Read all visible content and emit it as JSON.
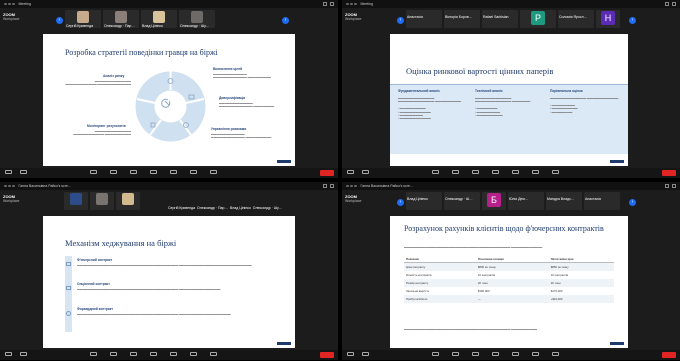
{
  "quadrants": [
    {
      "window_title": "Meeting",
      "brand": [
        "ZOOM",
        "Workplace"
      ],
      "participants": [
        "Сергій Кривенда",
        "Олександр · Пар…",
        "Влад Цінінко",
        "Олександр · Шу…"
      ],
      "participant_subs": [
        "",
        "",
        "",
        "Владислав Шумельчу…"
      ],
      "slide_title": "Розробка стратегії поведінки гравця на біржі",
      "labels": [
        "Аналіз ринку",
        "Моніторинг результатів",
        "Визначення цілей",
        "Диверсифікація",
        "Управління ризиками"
      ]
    },
    {
      "window_title": "Meeting",
      "brand": [
        "ZOOM",
        "Workplace"
      ],
      "participants": [
        "Анастасія",
        "Вікторія Боров…",
        "Rafael Sarkisian",
        "Соломія Яросл…"
      ],
      "participant_subs": [
        "",
        "",
        "",
        ""
      ],
      "slide_title": "Оцінка ринкової вартості цінних паперів",
      "columns": [
        "Фундаментальний аналіз",
        "Технічний аналіз",
        "Порівняльна оцінка"
      ]
    },
    {
      "window_title": "Ганна Васильівна Райко's scre…",
      "brand": [
        "ZOOM",
        "Workplace"
      ],
      "participants": [
        "",
        "",
        "",
        "Сергій Кривенда",
        "Олександр · Пар…",
        "Влад Цінінко",
        "Олександр · Шу…"
      ],
      "slide_title": "Механізм хеджування на біржі",
      "rows": [
        "Ф'ючерсний контракт",
        "Опціонний контракт",
        "Форвардний контракт"
      ]
    },
    {
      "window_title": "Ганна Васильівна Райко's scre…",
      "brand": [
        "ZOOM",
        "Workplace"
      ],
      "participants": [
        "Влад Цінінко",
        "Олександр · Ш…",
        "",
        "Юлія Дем…",
        "Мандра Владс…",
        "Анастасія"
      ],
      "slide_title": "Розрахунок рахунків клієнтів щодо ф'ючерсних контрактів",
      "table_headers": [
        "Показник",
        "Початкова позиція",
        "Після зміни ціни"
      ],
      "table_rows": [
        [
          "Ціна контракту",
          "$800 за тонну",
          "$850 за тонну"
        ],
        [
          "Кількість контрактів",
          "10 контрактів",
          "10 контрактів"
        ],
        [
          "Розмір контракту",
          "20 тонн",
          "20 тонн"
        ],
        [
          "Загальна вартість",
          "$160,000",
          "$170,000"
        ],
        [
          "Прибуток/збиток",
          "—",
          "+$10,000"
        ]
      ]
    }
  ],
  "colors": {
    "panel_green": "#1d9a80",
    "panel_purple": "#5b2bb5",
    "panel_pink": "#b5208a",
    "zoom_blue": "#1e6cf2",
    "end_red": "#e12424"
  }
}
